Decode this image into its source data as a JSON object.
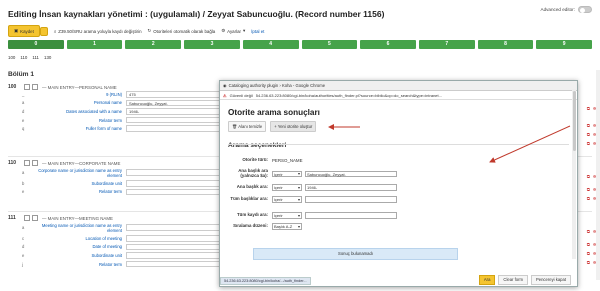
{
  "page": {
    "title": "Editing İnsan kaynakları yönetimi : (uygulamalı) / Zeyyat Sabuncuoğlu. (Record number 1156)",
    "advanced_editor": "Advanced editor:"
  },
  "toolbar": {
    "save": "Kaydet",
    "z3950": "Z39.50/SRU arama yoluyla kaydı değiştirin",
    "link_auth": "Otoriteleri otomatik olarak bağla",
    "settings": "Ayarlar",
    "cancel": "İptal et"
  },
  "tabs": [
    "0",
    "1",
    "2",
    "3",
    "4",
    "5",
    "6",
    "7",
    "8",
    "9"
  ],
  "subtabs": [
    "100",
    "110",
    "111",
    "130"
  ],
  "section": "Bölüm 1",
  "fields": [
    {
      "tag": "100",
      "desc": "— MAIN ENTRY—PERSONAL NAME",
      "subs": [
        {
          "code": "_",
          "label": "9 (RLIN)",
          "value": "475"
        },
        {
          "code": "a",
          "label": "Personal name",
          "value": "Sabuncuoğlu, Zeyyat."
        },
        {
          "code": "d",
          "label": "Dates associated with a name",
          "value": "1946-"
        },
        {
          "code": "e",
          "label": "Relator term",
          "value": ""
        },
        {
          "code": "q",
          "label": "Fuller form of name",
          "value": ""
        }
      ]
    },
    {
      "tag": "110",
      "desc": "— MAIN ENTRY—CORPORATE NAME",
      "subs": [
        {
          "code": "a",
          "label": "Corporate name or jurisdiction name as entry element",
          "value": ""
        },
        {
          "code": "b",
          "label": "Subordinate unit",
          "value": ""
        },
        {
          "code": "e",
          "label": "Relator term",
          "value": ""
        }
      ]
    },
    {
      "tag": "111",
      "desc": "— MAIN ENTRY—MEETING NAME",
      "subs": [
        {
          "code": "a",
          "label": "Meeting name or jurisdiction name as entry element",
          "value": ""
        },
        {
          "code": "c",
          "label": "Location of meeting",
          "value": ""
        },
        {
          "code": "d",
          "label": "Date of meeting",
          "value": ""
        },
        {
          "code": "e",
          "label": "Subordinate unit",
          "value": ""
        },
        {
          "code": "j",
          "label": "Relator term",
          "value": ""
        }
      ]
    }
  ],
  "popup": {
    "window_title": "Cataloging authority plugin › Koha - Google Chrome",
    "insecure": "Güvenli değil",
    "url": "54.236.63.223:8080/cgi-bin/koha/authorities/auth_finder.pl?source=biblio&op=do_search&type=intranet...",
    "heading": "Otorite arama sonuçları",
    "clear_field": "Alanı temizle",
    "new_authority": "+ Yeni otorite oluştur",
    "options_heading": "Arama seçenekleri",
    "auth_type_label": "Otorite türü:",
    "auth_type_value": "PERSO_NAME",
    "main_heading_only_label": "Ana başlık ara (yalnızca $a):",
    "main_heading_only_op": "içerir",
    "main_heading_only_value": "Sabuncuoğlu, Zeyyat.",
    "main_heading_label": "Ana başlık ara:",
    "main_heading_op": "içerir",
    "main_heading_value": "1946-",
    "all_headings_label": "Tüm başlıklar ara:",
    "all_headings_op": "içerir",
    "all_headings_value": "",
    "entire_record_label": "Tüm kaydı ara:",
    "entire_record_op": "içerir",
    "entire_record_value": "",
    "sort_label": "Sıralama düzeni:",
    "sort_value": "Başlık A-Z",
    "no_results": "Sonuç bulunamadı",
    "search_button": "Ara",
    "clear_form_button": "Clear form",
    "close_button": "Pencereyi kapat",
    "status_url": "54.236.63.223:8080/cgi-bin/koha/.../auth_finder..."
  }
}
